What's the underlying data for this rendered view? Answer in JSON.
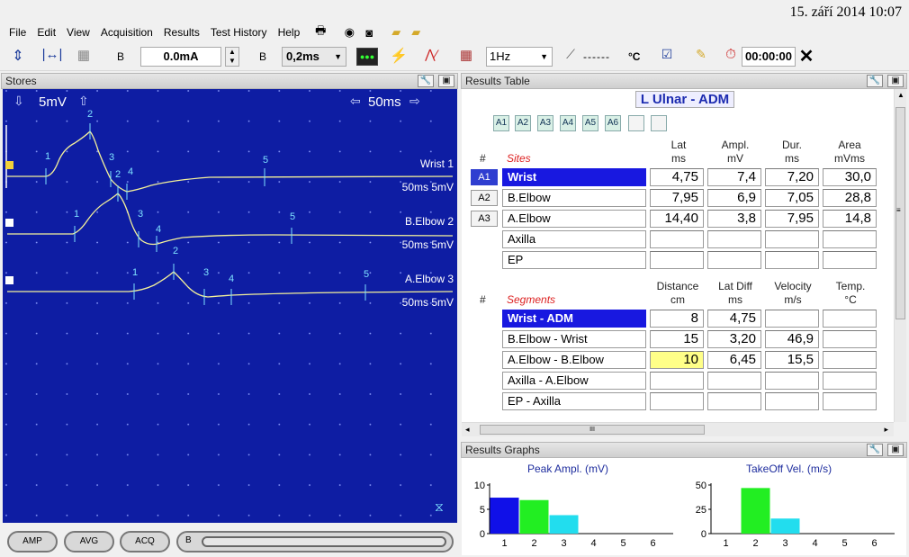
{
  "datetime": "15. září 2014 10:07",
  "menu": [
    "File",
    "Edit",
    "View",
    "Acquisition",
    "Results",
    "Test History",
    "Help"
  ],
  "toolbar": {
    "channel_b1": "B",
    "current": "0.0mA",
    "channel_b2": "B",
    "duration": "0,2ms",
    "rate": "1Hz",
    "temp": "------",
    "temp_unit": "°C",
    "timer": "00:00:00"
  },
  "stores": {
    "title": "Stores",
    "sensitivity": "5mV",
    "sweep": "50ms",
    "traces": [
      {
        "name": "Wrist 1",
        "scale": "50ms 5mV",
        "cursors": [
          "1",
          "2",
          "3",
          "4",
          "5"
        ]
      },
      {
        "name": "B.Elbow 2",
        "scale": "50ms 5mV",
        "cursors": [
          "1",
          "2",
          "3",
          "4",
          "5"
        ]
      },
      {
        "name": "A.Elbow 3",
        "scale": "50ms 5mV",
        "cursors": [
          "1",
          "2",
          "3",
          "4",
          "5"
        ]
      }
    ]
  },
  "results_table": {
    "title": "Results Table",
    "heading": "L Ulnar - ADM",
    "avg_buttons": [
      "A1",
      "A2",
      "A3",
      "A4",
      "A5",
      "A6",
      "",
      ""
    ],
    "sites_hash": "#",
    "sites_label": "Sites",
    "site_headers": [
      [
        "Lat",
        "ms"
      ],
      [
        "Ampl.",
        "mV"
      ],
      [
        "Dur.",
        "ms"
      ],
      [
        "Area",
        "mVms"
      ]
    ],
    "sites": [
      {
        "tag": "A1",
        "name": "Wrist",
        "lat": "4,75",
        "ampl": "7,4",
        "dur": "7,20",
        "area": "30,0"
      },
      {
        "tag": "A2",
        "name": "B.Elbow",
        "lat": "7,95",
        "ampl": "6,9",
        "dur": "7,05",
        "area": "28,8"
      },
      {
        "tag": "A3",
        "name": "A.Elbow",
        "lat": "14,40",
        "ampl": "3,8",
        "dur": "7,95",
        "area": "14,8"
      },
      {
        "tag": "",
        "name": "Axilla",
        "lat": "",
        "ampl": "",
        "dur": "",
        "area": ""
      },
      {
        "tag": "",
        "name": "EP",
        "lat": "",
        "ampl": "",
        "dur": "",
        "area": ""
      }
    ],
    "segments_hash": "#",
    "segments_label": "Segments",
    "segment_headers": [
      [
        "Distance",
        "cm"
      ],
      [
        "Lat Diff",
        "ms"
      ],
      [
        "Velocity",
        "m/s"
      ],
      [
        "Temp.",
        "°C"
      ]
    ],
    "segments": [
      {
        "name": "Wrist - ADM",
        "distance": "8",
        "latdiff": "4,75",
        "velocity": "",
        "temp": ""
      },
      {
        "name": "B.Elbow - Wrist",
        "distance": "15",
        "latdiff": "3,20",
        "velocity": "46,9",
        "temp": ""
      },
      {
        "name": "A.Elbow - B.Elbow",
        "distance": "10",
        "latdiff": "6,45",
        "velocity": "15,5",
        "temp": ""
      },
      {
        "name": "Axilla - A.Elbow",
        "distance": "",
        "latdiff": "",
        "velocity": "",
        "temp": ""
      },
      {
        "name": "EP - Axilla",
        "distance": "",
        "latdiff": "",
        "velocity": "",
        "temp": ""
      }
    ],
    "hscroll_grip": "III"
  },
  "results_graphs": {
    "title": "Results Graphs"
  },
  "bottom": {
    "amp": "AMP",
    "avg": "AVG",
    "acq": "ACQ",
    "b": "B"
  },
  "colors": {
    "trace_bg": "#0e1da3",
    "select_blue": "#1818e0",
    "bar_blue": "#1010e8",
    "bar_green": "#22ee22",
    "bar_cyan": "#22ddee",
    "highlight_yellow": "#ffff88"
  },
  "chart_data": [
    {
      "type": "bar",
      "title": "Peak Ampl. (mV)",
      "categories": [
        "1",
        "2",
        "3",
        "4",
        "5",
        "6"
      ],
      "values": [
        7.4,
        6.9,
        3.8,
        null,
        null,
        null
      ],
      "ylim": [
        0,
        10
      ],
      "yticks": [
        "0",
        "5",
        "10"
      ]
    },
    {
      "type": "bar",
      "title": "TakeOff Vel. (m/s)",
      "categories": [
        "1",
        "2",
        "3",
        "4",
        "5",
        "6"
      ],
      "values": [
        null,
        46.9,
        15.5,
        null,
        null,
        null
      ],
      "ylim": [
        0,
        50
      ],
      "yticks": [
        "0",
        "25",
        "50"
      ]
    }
  ]
}
